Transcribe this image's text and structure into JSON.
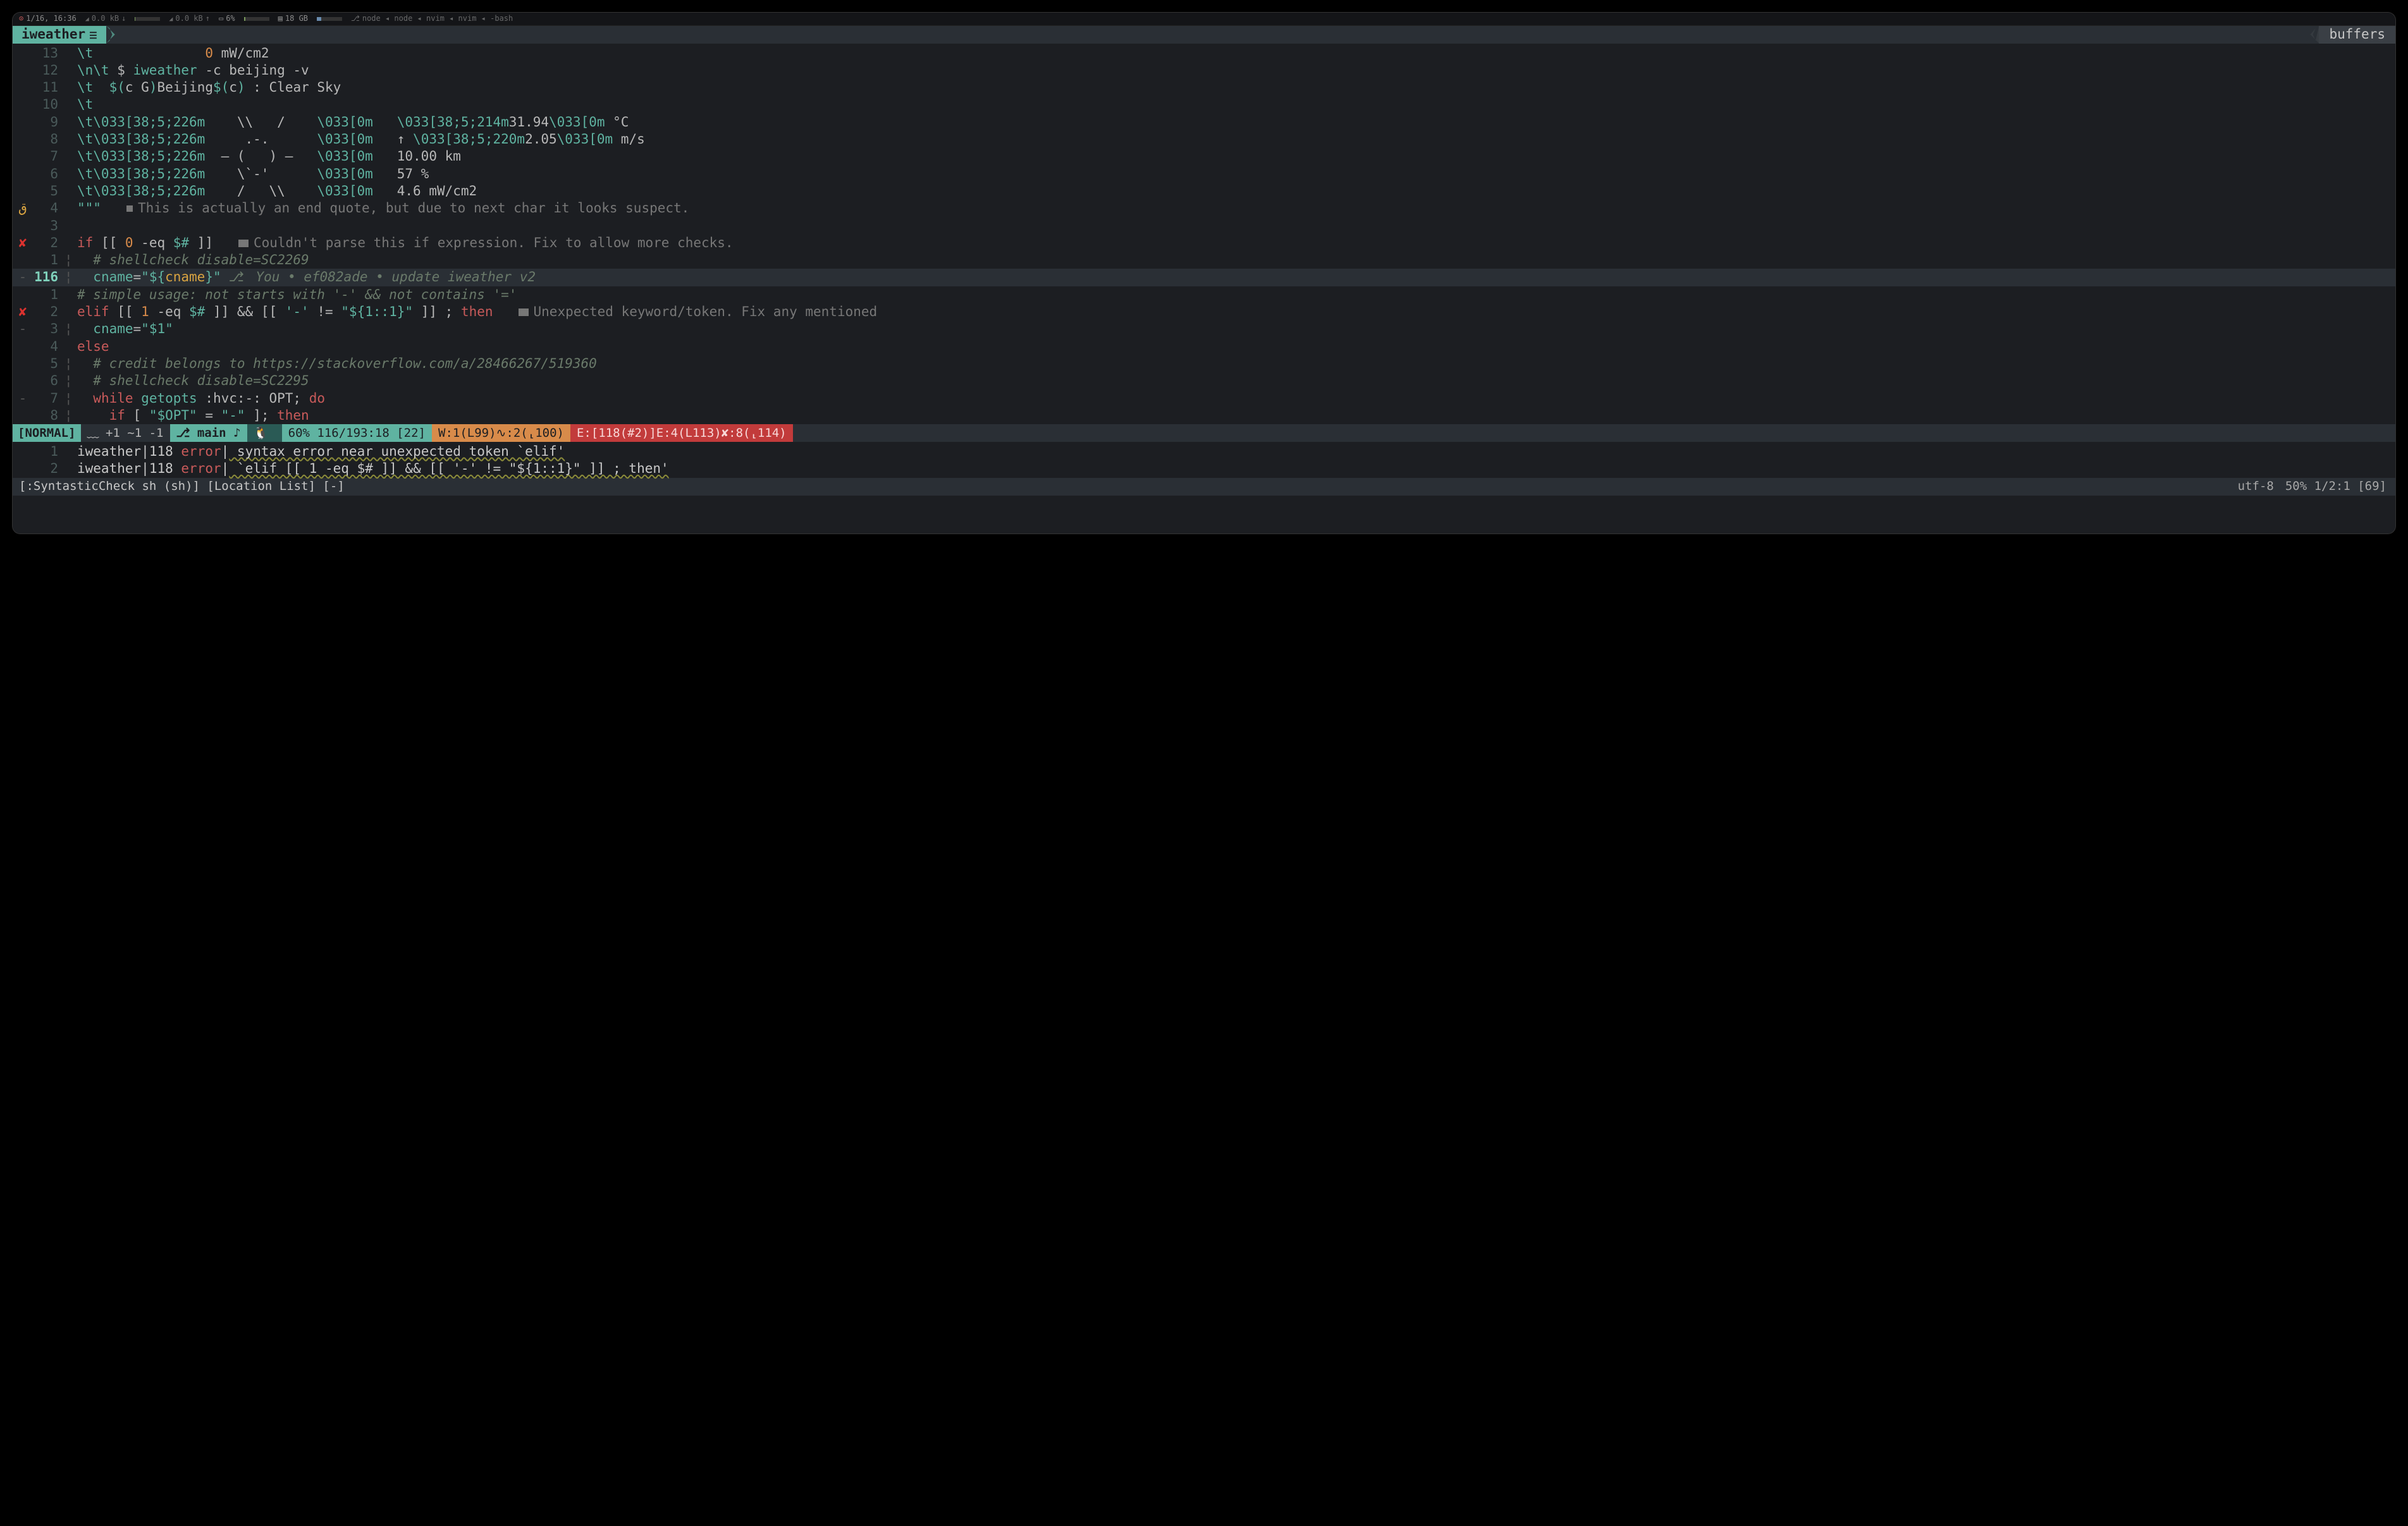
{
  "sysbar": {
    "clock": "1/16, 16:36",
    "net_down": "0.0 kB",
    "net_up": "0.0 kB",
    "battery": "6%",
    "memory": "18 GB",
    "procs": "node ◂ node ◂ nvim ◂ nvim ◂ -bash"
  },
  "tabline": {
    "active": "iweather",
    "right": "buffers"
  },
  "blame": {
    "author": "You",
    "hash": "ef082ade",
    "msg": "update iweather v2"
  },
  "lines": [
    {
      "sign": "",
      "nr": "13",
      "fold": "",
      "segs": [
        [
          "esc",
          "\\t"
        ],
        [
          "op",
          "              "
        ],
        [
          "num",
          "0"
        ],
        [
          "op",
          " mW/cm2"
        ]
      ]
    },
    {
      "sign": "",
      "nr": "12",
      "fold": "",
      "segs": [
        [
          "esc",
          "\\n\\t"
        ],
        [
          "op",
          " $ "
        ],
        [
          "teal",
          "iweather"
        ],
        [
          "op",
          " -c beijing -v"
        ]
      ]
    },
    {
      "sign": "",
      "nr": "11",
      "fold": "",
      "segs": [
        [
          "esc",
          "\\t"
        ],
        [
          "op",
          "  "
        ],
        [
          "teal",
          "$("
        ],
        [
          "op",
          "c G"
        ],
        [
          "teal",
          ")"
        ],
        [
          "op",
          "Beijing"
        ],
        [
          "teal",
          "$("
        ],
        [
          "op",
          "c"
        ],
        [
          "teal",
          ")"
        ],
        [
          "op",
          " : Clear Sky"
        ]
      ]
    },
    {
      "sign": "",
      "nr": "10",
      "fold": "",
      "segs": [
        [
          "esc",
          "\\t"
        ]
      ]
    },
    {
      "sign": "",
      "nr": "9",
      "fold": "",
      "segs": [
        [
          "esc",
          "\\t\\033[38;5;226m"
        ],
        [
          "op",
          "    \\\\   /    "
        ],
        [
          "esc",
          "\\033[0m"
        ],
        [
          "op",
          "   "
        ],
        [
          "esc",
          "\\033[38;5;214m"
        ],
        [
          "op",
          "31.94"
        ],
        [
          "esc",
          "\\033[0m"
        ],
        [
          "op",
          " °C"
        ]
      ]
    },
    {
      "sign": "",
      "nr": "8",
      "fold": "",
      "segs": [
        [
          "esc",
          "\\t\\033[38;5;226m"
        ],
        [
          "op",
          "     .-.      "
        ],
        [
          "esc",
          "\\033[0m"
        ],
        [
          "op",
          "   ↑ "
        ],
        [
          "esc",
          "\\033[38;5;220m"
        ],
        [
          "op",
          "2.05"
        ],
        [
          "esc",
          "\\033[0m"
        ],
        [
          "op",
          " m/s"
        ]
      ]
    },
    {
      "sign": "",
      "nr": "7",
      "fold": "",
      "segs": [
        [
          "esc",
          "\\t\\033[38;5;226m"
        ],
        [
          "op",
          "  ― (   ) ―   "
        ],
        [
          "esc",
          "\\033[0m"
        ],
        [
          "op",
          "   10.00 km"
        ]
      ]
    },
    {
      "sign": "",
      "nr": "6",
      "fold": "",
      "segs": [
        [
          "esc",
          "\\t\\033[38;5;226m"
        ],
        [
          "op",
          "    \\`-'      "
        ],
        [
          "esc",
          "\\033[0m"
        ],
        [
          "op",
          "   57 %"
        ]
      ]
    },
    {
      "sign": "",
      "nr": "5",
      "fold": "",
      "segs": [
        [
          "esc",
          "\\t\\033[38;5;226m"
        ],
        [
          "op",
          "    /   \\\\    "
        ],
        [
          "esc",
          "\\033[0m"
        ],
        [
          "op",
          "   4.6 mW/cm2"
        ]
      ]
    },
    {
      "sign": "ق",
      "signcls": "warn",
      "nr": "4",
      "fold": "",
      "segs": [
        [
          "string",
          "\"\"\""
        ]
      ],
      "diag": "This is actually an end quote, but due to next char it looks suspect.",
      "diagsmall": true
    },
    {
      "sign": "",
      "nr": "3",
      "fold": "",
      "segs": []
    },
    {
      "sign": "✘",
      "signcls": "err",
      "nr": "2",
      "fold": "",
      "segs": [
        [
          "keyword",
          "if"
        ],
        [
          "op",
          " [[ "
        ],
        [
          "num",
          "0"
        ],
        [
          "op",
          " -eq "
        ],
        [
          "teal",
          "$#"
        ],
        [
          "op",
          " ]]"
        ]
      ],
      "diag": "Couldn't parse this if expression. Fix to allow more checks."
    },
    {
      "sign": "",
      "nr": "1",
      "fold": "¦",
      "segs": [
        [
          "comment",
          "  # shellcheck disable=SC2269"
        ]
      ]
    },
    {
      "sign": "-",
      "signcls": "dash",
      "nr": "116",
      "nrcls": "current",
      "fold": "¦",
      "cursorline": true,
      "segs": [
        [
          "op",
          "  "
        ],
        [
          "teal",
          "cname"
        ],
        [
          "op",
          "="
        ],
        [
          "string",
          "\"${"
        ],
        [
          "var",
          "cname"
        ],
        [
          "string",
          "}"
        ],
        [
          "string",
          "\""
        ]
      ],
      "blame": true,
      "cursorUnderlineIdx": 7
    },
    {
      "sign": "",
      "nr": "1",
      "fold": "",
      "segs": [
        [
          "comment",
          "# simple usage: not starts with '-' && not contains '='"
        ]
      ]
    },
    {
      "sign": "✘",
      "signcls": "err",
      "nr": "2",
      "fold": "",
      "segs": [
        [
          "keyword",
          "elif"
        ],
        [
          "op",
          " [[ "
        ],
        [
          "num",
          "1"
        ],
        [
          "op",
          " -eq "
        ],
        [
          "teal",
          "$#"
        ],
        [
          "op",
          " ]] && [[ "
        ],
        [
          "string",
          "'-'"
        ],
        [
          "op",
          " != "
        ],
        [
          "string",
          "\"${1::1}\""
        ],
        [
          "op",
          " ]] ; "
        ],
        [
          "keyword",
          "then"
        ]
      ],
      "diag": "Unexpected keyword/token. Fix any mentioned"
    },
    {
      "sign": "-",
      "signcls": "dash",
      "nr": "3",
      "fold": "¦",
      "segs": [
        [
          "op",
          "  "
        ],
        [
          "teal",
          "cname"
        ],
        [
          "op",
          "="
        ],
        [
          "string",
          "\"$1\""
        ]
      ]
    },
    {
      "sign": "",
      "nr": "4",
      "fold": "",
      "segs": [
        [
          "keyword",
          "else"
        ]
      ]
    },
    {
      "sign": "",
      "nr": "5",
      "fold": "¦",
      "segs": [
        [
          "comment",
          "  # credit belongs to https://stackoverflow.com/a/28466267/519360"
        ]
      ]
    },
    {
      "sign": "",
      "nr": "6",
      "fold": "¦",
      "segs": [
        [
          "comment",
          "  # shellcheck disable=SC2295"
        ]
      ]
    },
    {
      "sign": "-",
      "signcls": "dash",
      "nr": "7",
      "fold": "¦",
      "segs": [
        [
          "op",
          "  "
        ],
        [
          "keyword",
          "while"
        ],
        [
          "op",
          " "
        ],
        [
          "teal",
          "getopts"
        ],
        [
          "op",
          " :hvc:-: OPT; "
        ],
        [
          "keyword",
          "do"
        ]
      ]
    },
    {
      "sign": "",
      "nr": "8",
      "fold": "¦",
      "segs": [
        [
          "op",
          "    "
        ],
        [
          "keyword",
          "if"
        ],
        [
          "op",
          " [ "
        ],
        [
          "string",
          "\"$OPT\""
        ],
        [
          "op",
          " = "
        ],
        [
          "string",
          "\"-\""
        ],
        [
          "op",
          " ]; "
        ],
        [
          "keyword",
          "then"
        ]
      ]
    }
  ],
  "statusline": {
    "mode": "[NORMAL]",
    "diff": "+1 ~1 -1",
    "branch": "main",
    "music": "♪",
    "sys_apple": "",
    "pos": "60% 116/193:18 [22]",
    "warn": "W:1(L99)∿:2(⸤100)",
    "err": "E:[118(#2)]E:4(L113)✘:8(⸤114)"
  },
  "loclist": [
    {
      "nr": "1",
      "file": "iweather",
      "line": "118",
      "level": "error",
      "msg": " syntax error near unexpected token `elif'"
    },
    {
      "nr": "2",
      "file": "iweather",
      "line": "118",
      "level": "error",
      "msg": " `elif [[ 1 -eq $# ]] && [[ '-' != \"${1::1}\" ]] ; then'"
    }
  ],
  "bottom": {
    "left": "[:SyntasticCheck sh (sh)] [Location List] [-]",
    "encoding": "utf-8 ",
    "pos": "50% 1/2:1 [69]"
  }
}
